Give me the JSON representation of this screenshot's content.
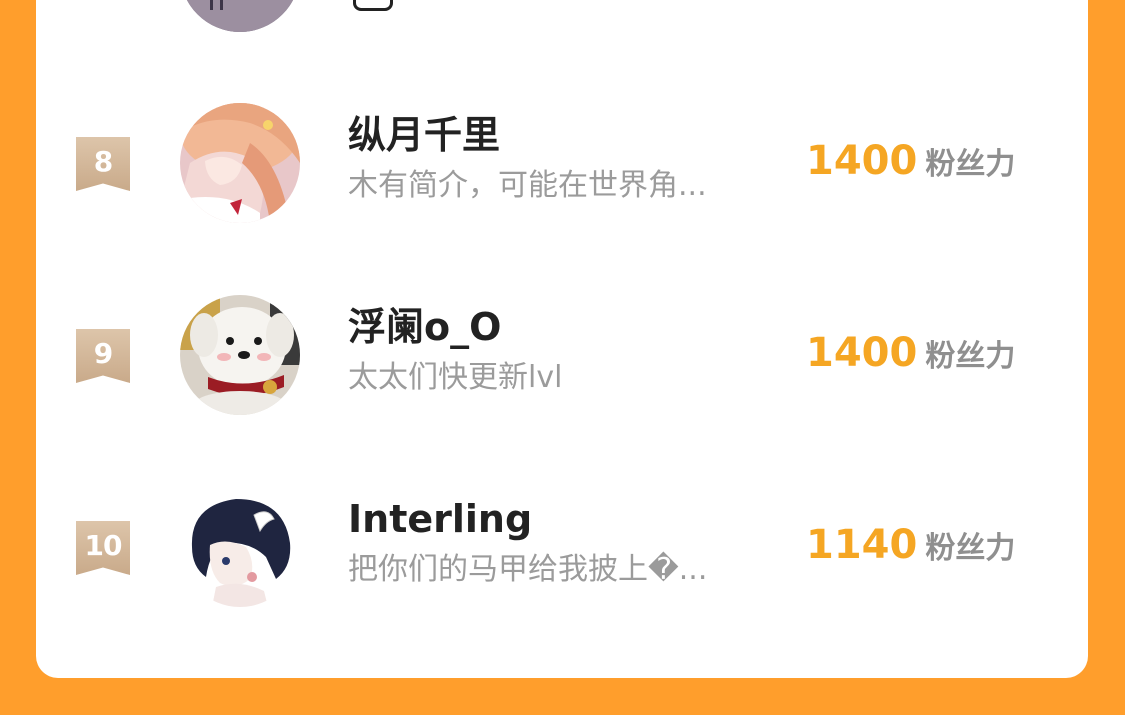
{
  "list": {
    "rows": [
      {
        "rank": "8",
        "name": "纵月千里",
        "bio": "木有简介，可能在世界角...",
        "score": "1400",
        "unit": "粉丝力",
        "avatar": "anime-girl-avatar"
      },
      {
        "rank": "9",
        "name": "浮阑o_O",
        "bio": "太太们快更新lvl",
        "score": "1400",
        "unit": "粉丝力",
        "avatar": "plush-dog-avatar"
      },
      {
        "rank": "10",
        "name": "Interling",
        "bio": "把你们的马甲给我披上�...",
        "score": "1140",
        "unit": "粉丝力",
        "avatar": "dark-hair-boy-avatar"
      }
    ]
  },
  "colors": {
    "background": "#FF9E2C",
    "panel": "#ffffff",
    "score": "#F5A623",
    "name": "#222222",
    "bio": "#9B9B9B",
    "rank_badge": "#D6BB9C"
  }
}
